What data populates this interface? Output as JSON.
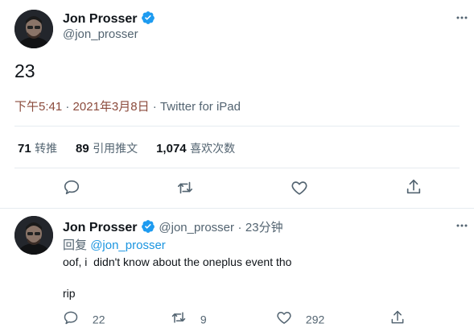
{
  "main_tweet": {
    "author_name": "Jon Prosser",
    "author_handle": "@jon_prosser",
    "text": "23",
    "time": "下午5:41",
    "date": "2021年3月8日",
    "source": "Twitter for iPad",
    "dot": "·"
  },
  "stats": {
    "retweets_count": "71",
    "retweets_label": "转推",
    "quotes_count": "89",
    "quotes_label": "引用推文",
    "likes_count": "1,074",
    "likes_label": "喜欢次数"
  },
  "reply": {
    "author_name": "Jon Prosser",
    "author_handle": "@jon_prosser",
    "dot": "·",
    "time_ago": "23分钟",
    "reply_prefix": "回复",
    "reply_to": "@jon_prosser",
    "text_line1": "oof, i  didn't know about the oneplus event tho",
    "text_line2": "rip",
    "reply_count": "22",
    "retweet_count": "9",
    "like_count": "292"
  },
  "colors": {
    "verified": "#1d9bf0",
    "link": "#1b95e0",
    "muted": "#536471",
    "text": "#0f1419"
  },
  "icons": {
    "reply": "speech-bubble-icon",
    "retweet": "retweet-arrows-icon",
    "like": "heart-icon",
    "share": "share-upload-icon",
    "more": "more-dots-icon",
    "verified": "verified-badge-icon"
  }
}
